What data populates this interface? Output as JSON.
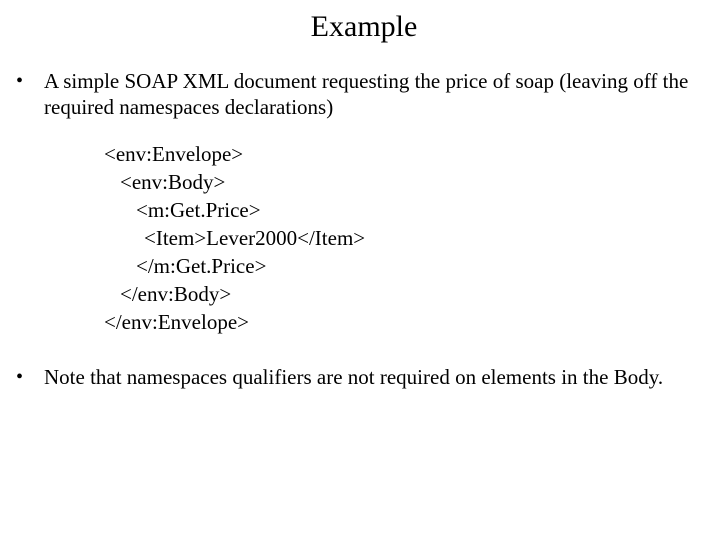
{
  "title": "Example",
  "bullets": {
    "b1": "A simple SOAP XML document requesting the price of soap (leaving off the required namespaces declarations)",
    "b2": "Note that namespaces qualifiers are not required on elements in the Body."
  },
  "code": {
    "line1": "<env:Envelope>",
    "line2": "<env:Body>",
    "line3": "<m:Get.Price>",
    "line4": "<Item>Lever2000</Item>",
    "line5": "</m:Get.Price>",
    "line6": "</env:Body>",
    "line7": "</env:Envelope>"
  },
  "bullet_glyph": "•"
}
